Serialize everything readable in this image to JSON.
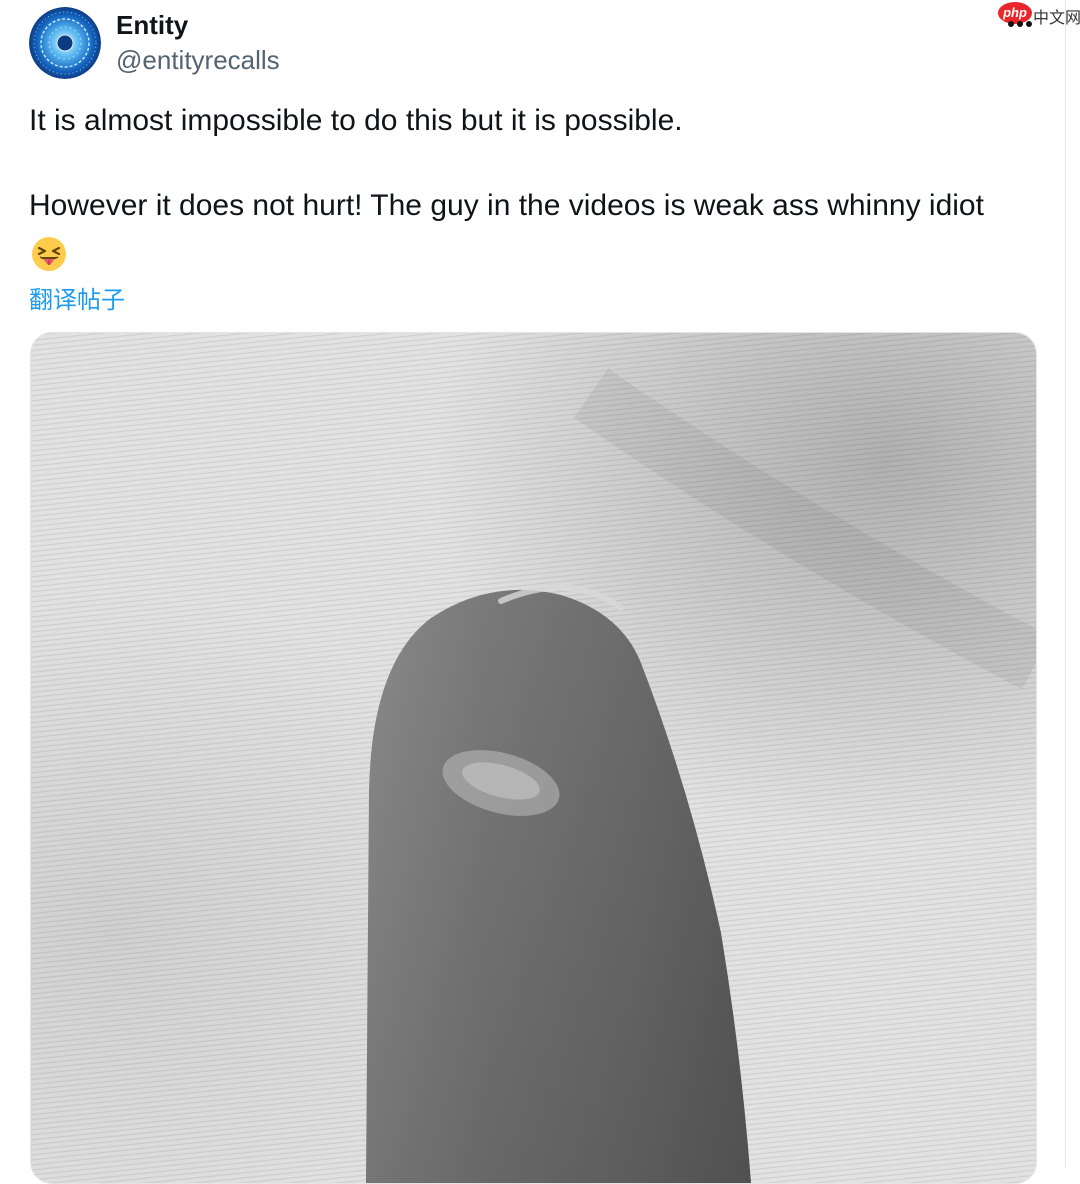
{
  "author": {
    "name": "Entity",
    "handle": "@entityrecalls",
    "avatar_icon": "blue-tech-sphere-avatar"
  },
  "tweet": {
    "line1": "It is almost impossible to do this but it is possible.",
    "line2": "However it does not hurt! The guy in the videos is weak ass whinny idiot",
    "emoji": "😝"
  },
  "translate_label": "翻译帖子",
  "watermark": {
    "badge": "php",
    "text": "中文网"
  },
  "media": {
    "icon": "photo-finger-on-fabric",
    "palette": {
      "fabric": "#e4e4e4",
      "finger": "#7a7a7a"
    }
  },
  "colors": {
    "text": "#0f1419",
    "secondary": "#536471",
    "link": "#1d9bf0"
  }
}
